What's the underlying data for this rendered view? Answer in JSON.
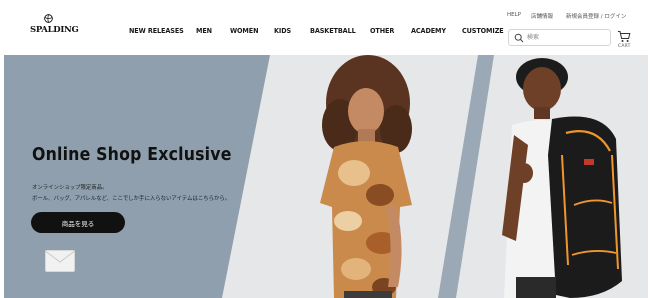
{
  "brand": {
    "logo_text": "SPALDING"
  },
  "nav": {
    "items": [
      {
        "label": "NEW RELEASES"
      },
      {
        "label": "MEN"
      },
      {
        "label": "WOMEN"
      },
      {
        "label": "KIDS"
      },
      {
        "label": "BASKETBALL"
      },
      {
        "label": "OTHER"
      },
      {
        "label": "ACADEMY"
      },
      {
        "label": "CUSTOMIZE"
      }
    ]
  },
  "utility": {
    "help": "HELP",
    "store_info": "店舗情報",
    "login": "新規会員登録 / ログイン"
  },
  "search": {
    "placeholder": "検索"
  },
  "cart": {
    "label": "CART"
  },
  "hero": {
    "headline": "Online Shop Exclusive",
    "sub_line1": "オンラインショップ限定商品。",
    "sub_line2": "ボール、バッグ、アパレルなど、ここでしか手に入らないアイテムはこちらから。",
    "cta_label": "商品を見る"
  },
  "colors": {
    "hero_gray": "#8f9fad",
    "hero_light": "#e6e7e8",
    "cta_bg": "#111111"
  },
  "icons": {
    "logo": "basketball-icon",
    "search": "search-icon",
    "cart": "cart-icon",
    "mail": "envelope-icon"
  }
}
